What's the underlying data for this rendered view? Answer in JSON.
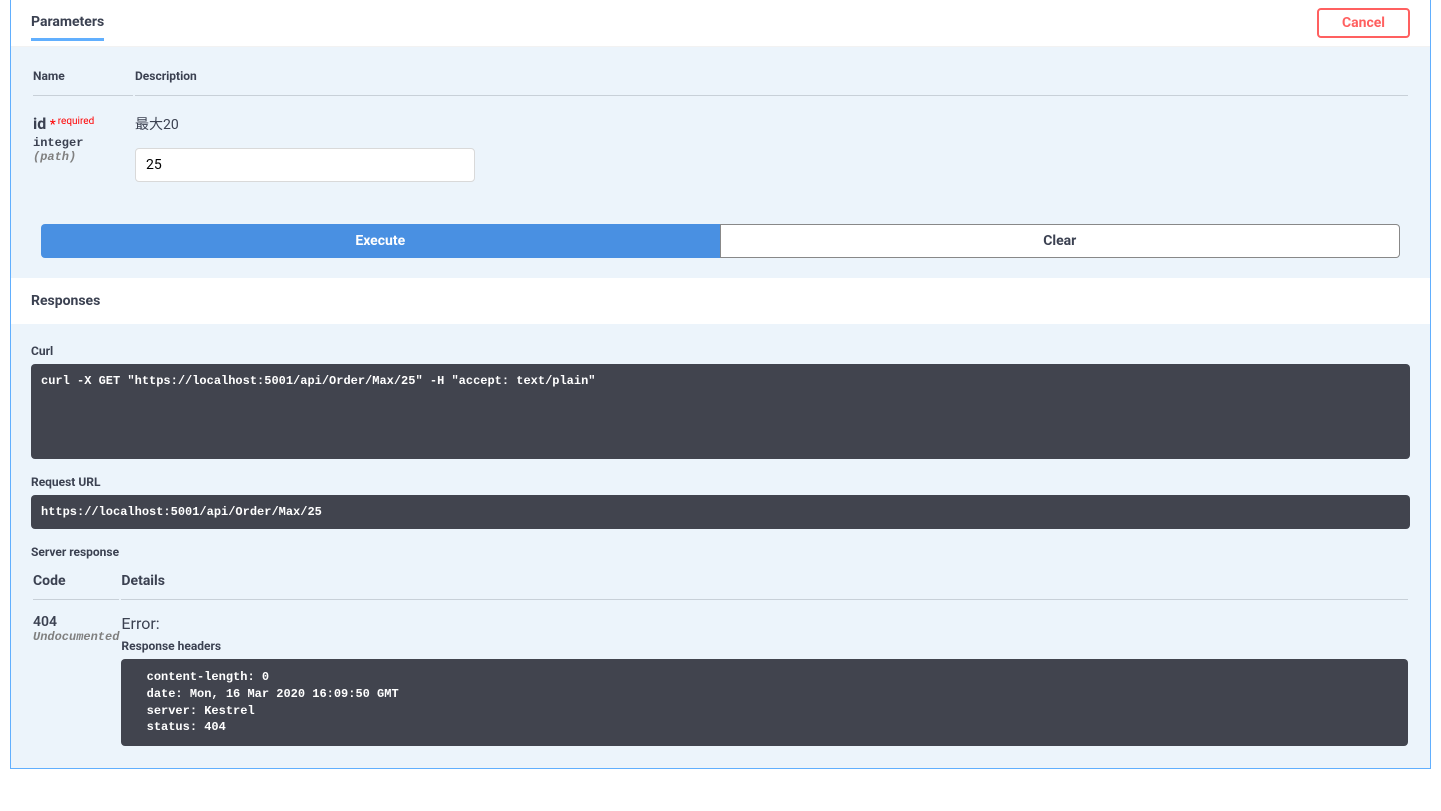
{
  "tabs": {
    "parameters": "Parameters"
  },
  "buttons": {
    "cancel": "Cancel",
    "execute": "Execute",
    "clear": "Clear"
  },
  "columns": {
    "name": "Name",
    "description": "Description",
    "code": "Code",
    "details": "Details"
  },
  "param": {
    "name": "id",
    "required_star": "*",
    "required_label": "required",
    "type": "integer",
    "in": "(path)",
    "description": "最大20",
    "value": "25"
  },
  "responses": {
    "title": "Responses",
    "curl_label": "Curl",
    "curl_command": "curl -X GET \"https://localhost:5001/api/Order/Max/25\" -H \"accept: text/plain\"",
    "request_url_label": "Request URL",
    "request_url": "https://localhost:5001/api/Order/Max/25",
    "server_response_label": "Server response",
    "status_code": "404",
    "undocumented": "Undocumented",
    "error_label": "Error:",
    "response_headers_label": "Response headers",
    "response_headers": " content-length: 0 \n date: Mon, 16 Mar 2020 16:09:50 GMT \n server: Kestrel \n status: 404 "
  }
}
